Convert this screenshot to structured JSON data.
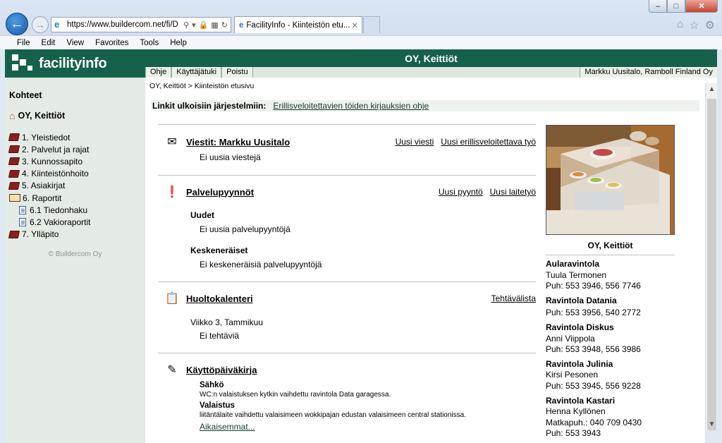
{
  "browser": {
    "url": "https://www.buildercom.net/fi/D",
    "tab_title": "FacilityInfo - Kiinteistön etu...",
    "menu": [
      "File",
      "Edit",
      "View",
      "Favorites",
      "Tools",
      "Help"
    ]
  },
  "header": {
    "logo_text": "facilityinfo",
    "title": "OY, Keittiöt",
    "nav": [
      "Ohje",
      "Käyttäjätuki",
      "Poistu"
    ],
    "user": "Markku Uusitalo, Ramboll Finland Oy"
  },
  "sidebar": {
    "title": "Kohteet",
    "root": "OY, Keittiöt",
    "items": [
      {
        "label": "1. Yleistiedot"
      },
      {
        "label": "2. Palvelut ja rajat"
      },
      {
        "label": "3. Kunnossapito"
      },
      {
        "label": "4. Kiinteistönhoito"
      },
      {
        "label": "5. Asiakirjat"
      },
      {
        "label": "6. Raportit"
      },
      {
        "label": "6.1 Tiedonhaku"
      },
      {
        "label": "6.2 Vakioraportit"
      },
      {
        "label": "7. Ylläpito"
      }
    ],
    "copyright": "© Buildercom Oy"
  },
  "content": {
    "breadcrumb": "OY, Keittiöt > Kiinteistön etusivu",
    "links_label": "Linkit ulkoisiin järjestelmiin:",
    "links_value": "Erillisveloitettavien töiden kirjauksien ohje",
    "messages": {
      "title": "Viestit: Markku Uusitalo",
      "link1": "Uusi viesti",
      "link2": "Uusi erillisveloitettava työ",
      "text": "Ei uusia viestejä"
    },
    "requests": {
      "title": "Palvelupyynnöt",
      "link1": "Uusi pyyntö",
      "link2": "Uusi laitetyö",
      "new_label": "Uudet",
      "new_text": "Ei uusia palvelupyyntöjä",
      "open_label": "Keskeneräiset",
      "open_text": "Ei keskeneräisiä palvelupyyntöjä"
    },
    "calendar": {
      "title": "Huoltokalenteri",
      "link1": "Tehtävälista",
      "week": "Viikko 3, Tammikuu",
      "text": "Ei tehtäviä"
    },
    "log": {
      "title": "Käyttöpäiväkirja",
      "e1_title": "Sähkö",
      "e1_text": "WC:n valaistuksen kytkin vaihdettu ravintola Data garagessa.",
      "e2_title": "Valaistus",
      "e2_text": "liitäntälaite vaihdettu valaisimeen wokkipajan edustan valaisimeen central stationissa.",
      "more": "Aikaisemmat..."
    }
  },
  "right_panel": {
    "caption": "OY, Keittiöt",
    "restaurants": [
      {
        "name": "Aularavintola",
        "lines": [
          "Tuula Termonen",
          "Puh: 553 3946, 556 7746"
        ]
      },
      {
        "name": "Ravintola Datania",
        "lines": [
          "Puh: 553 3956, 540 2772"
        ]
      },
      {
        "name": "Ravintola Diskus",
        "lines": [
          "Anni Viippola",
          "Puh: 553 3948, 556 3986"
        ]
      },
      {
        "name": "Ravintola Julinia",
        "lines": [
          "Kirsi Pesonen",
          "Puh: 553 3945, 556 9228"
        ]
      },
      {
        "name": "Ravintola Kastari",
        "lines": [
          "Henna Kyllönen",
          "Matkapuh.: 040 709 0430",
          "Puh: 553 3943"
        ]
      }
    ]
  }
}
